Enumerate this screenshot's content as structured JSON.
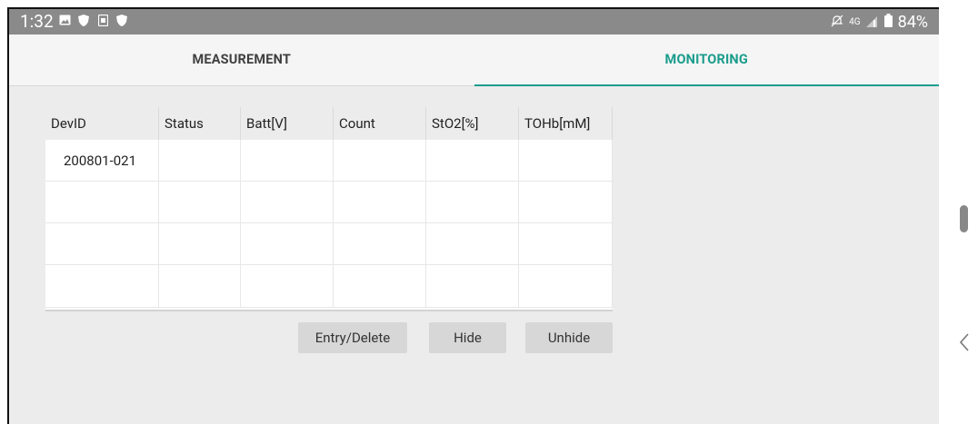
{
  "status_bar": {
    "time": "1:32",
    "network": "4G",
    "battery": "84%"
  },
  "tabs": [
    {
      "label": "MEASUREMENT",
      "selected": false
    },
    {
      "label": "MONITORING",
      "selected": true
    }
  ],
  "table": {
    "headers": [
      "DevID",
      "Status",
      "Batt[V]",
      "Count",
      "StO2[%]",
      "TOHb[mM]"
    ],
    "rows": [
      [
        "200801-021",
        "",
        "",
        "",
        "",
        ""
      ],
      [
        "",
        "",
        "",
        "",
        "",
        ""
      ],
      [
        "",
        "",
        "",
        "",
        "",
        ""
      ],
      [
        "",
        "",
        "",
        "",
        "",
        ""
      ]
    ]
  },
  "buttons": {
    "entry_delete": "Entry/Delete",
    "hide": "Hide",
    "unhide": "Unhide"
  },
  "colors": {
    "accent": "#1a9c8c",
    "status_bar": "#8a8a8a",
    "background": "#ececec",
    "button": "#d7d7d7"
  },
  "icons": [
    "gallery-icon",
    "shield-icon",
    "sim-icon",
    "shield-icon",
    "mute-icon",
    "signal-icon",
    "battery-icon",
    "back-chevron-icon"
  ]
}
